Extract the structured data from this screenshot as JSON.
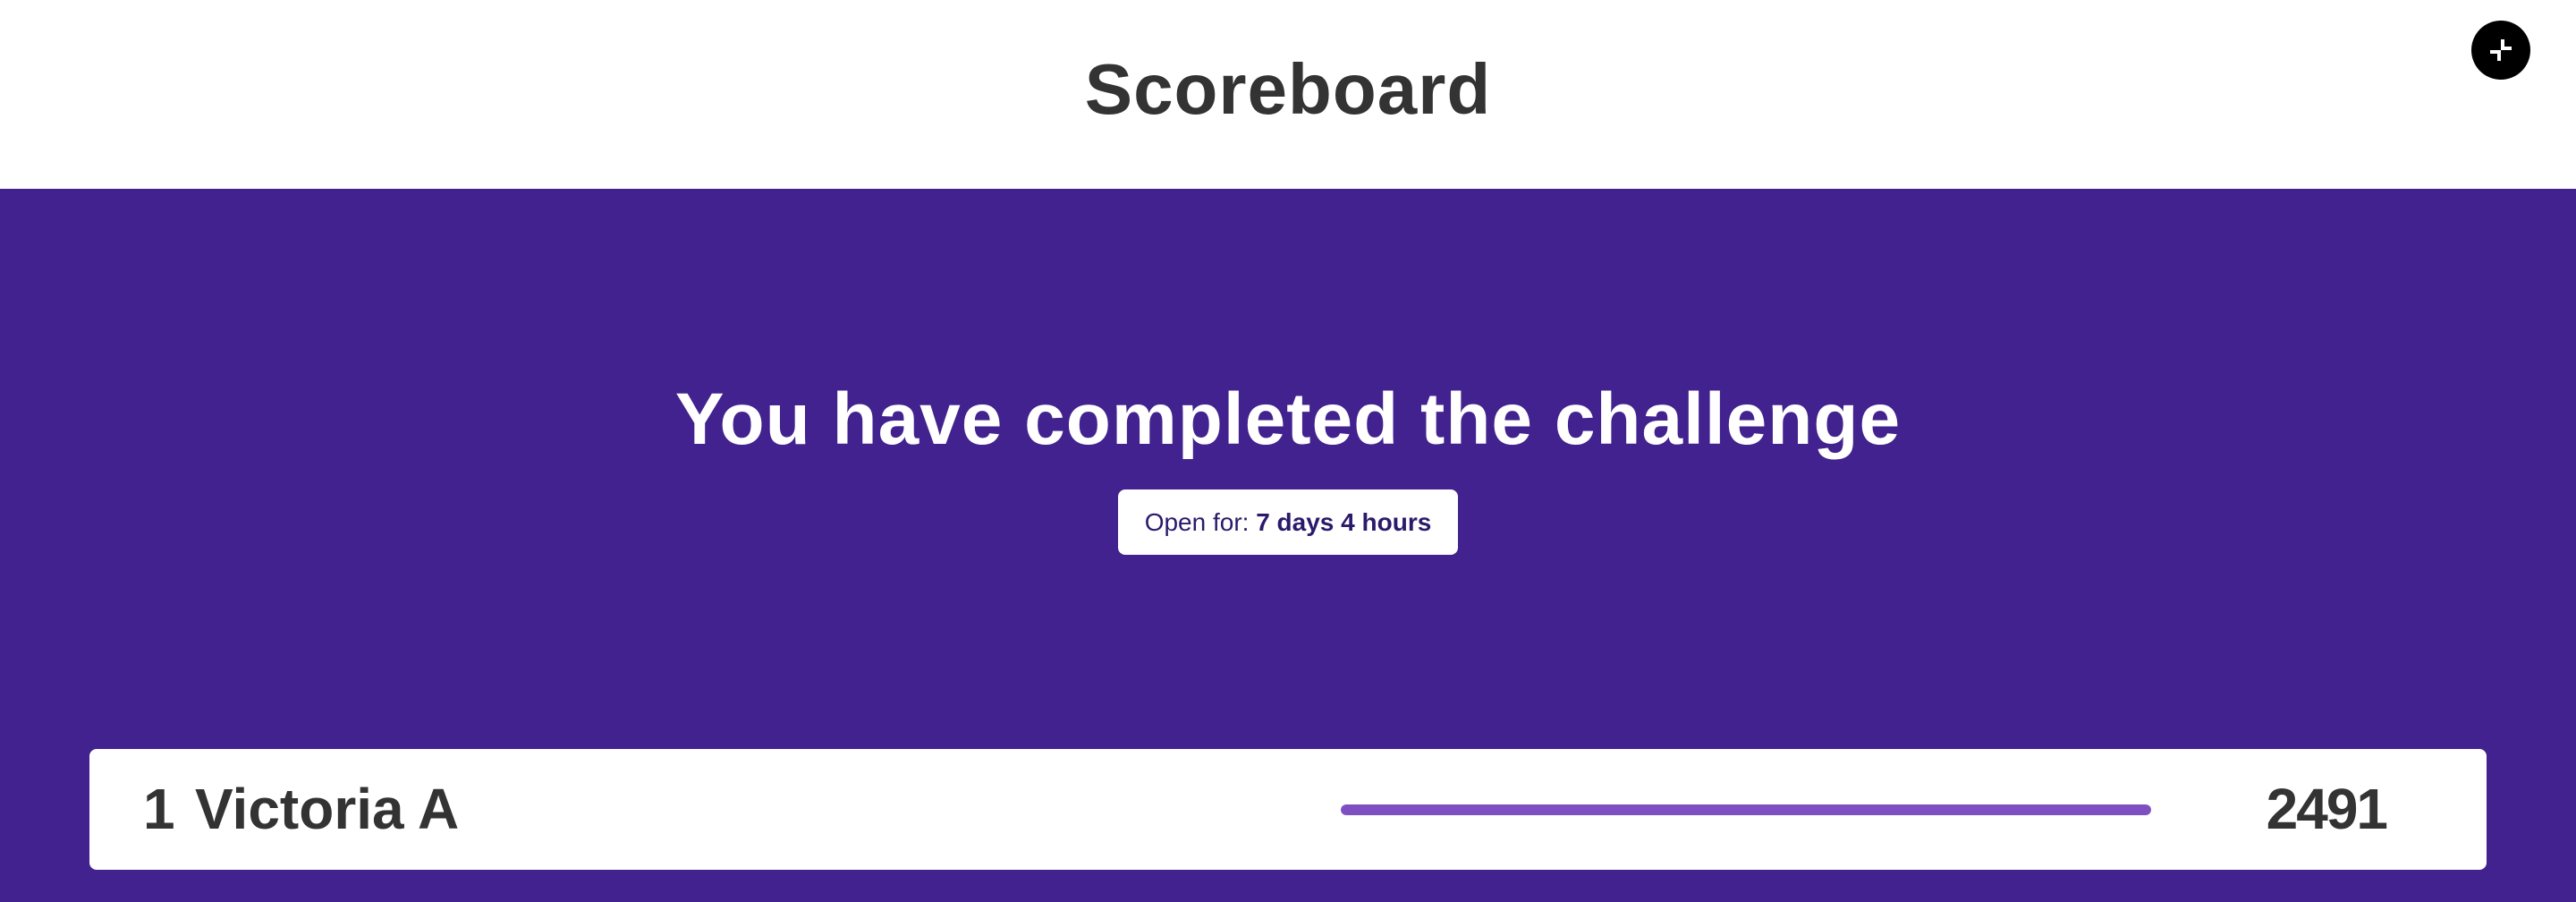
{
  "header": {
    "title": "Scoreboard",
    "fullscreen_icon": "exit-fullscreen-icon"
  },
  "status": {
    "headline": "You have completed the challenge",
    "open_for_label": "Open for:",
    "open_for_value": "7 days 4 hours"
  },
  "leaderboard": [
    {
      "rank": "1",
      "name": "Victoria A",
      "score": "2491",
      "progress_fraction": 1.0
    }
  ],
  "colors": {
    "header_background": "#ffffff",
    "main_background": "#41228e",
    "progress_bar": "#7e4fc0",
    "text_dark": "#333333"
  }
}
